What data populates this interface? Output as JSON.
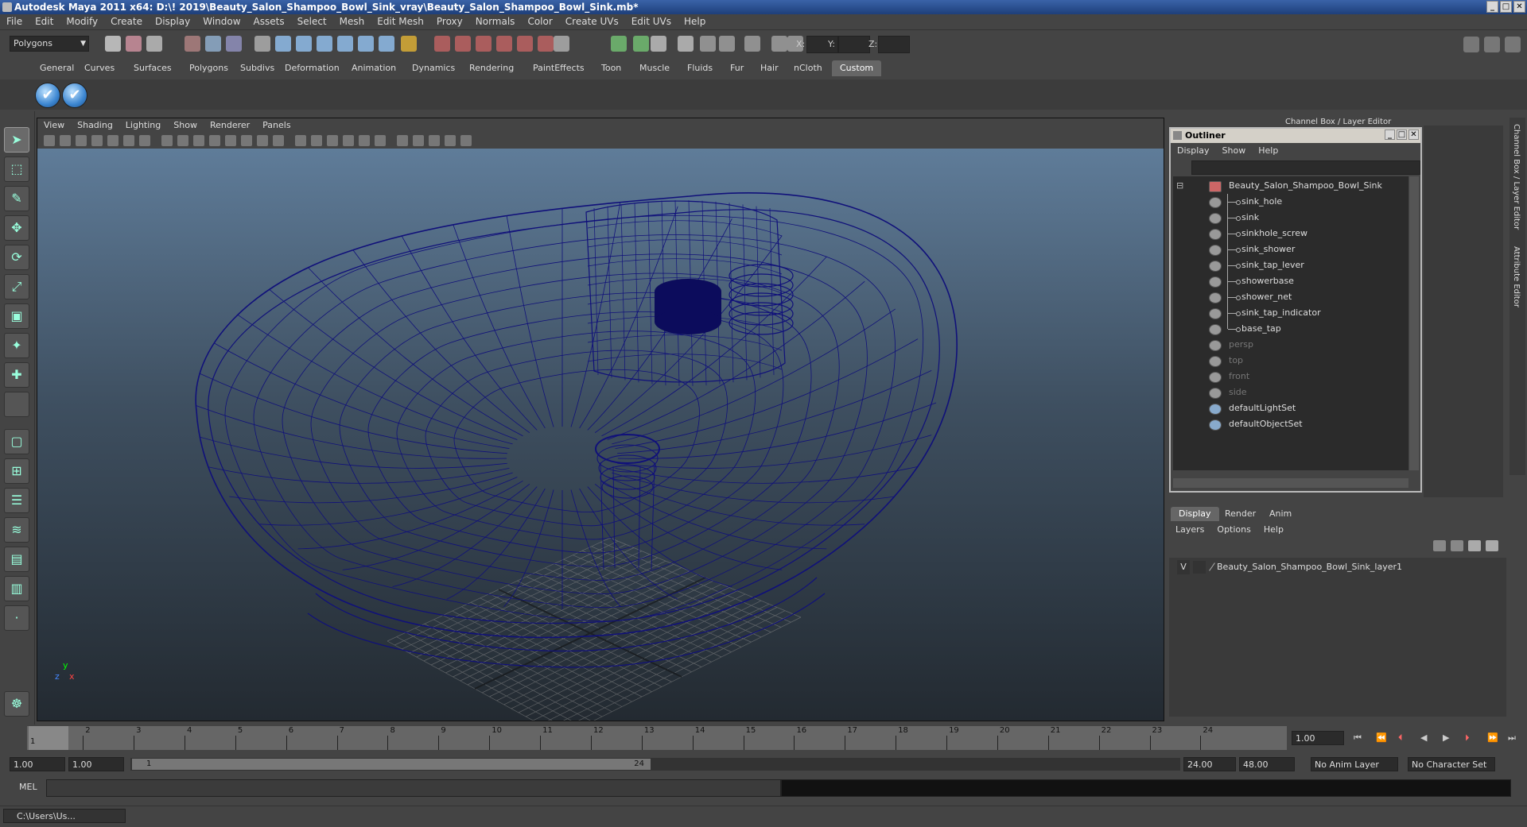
{
  "window": {
    "title": "Autodesk Maya 2011 x64: D:\\! 2019\\Beauty_Salon_Shampoo_Bowl_Sink_vray\\Beauty_Salon_Shampoo_Bowl_Sink.mb*"
  },
  "menubar": [
    "File",
    "Edit",
    "Modify",
    "Create",
    "Display",
    "Window",
    "Assets",
    "Select",
    "Mesh",
    "Edit Mesh",
    "Proxy",
    "Normals",
    "Color",
    "Create UVs",
    "Edit UVs",
    "Help"
  ],
  "statusline": {
    "mode_dropdown": "Polygons",
    "x_label": "X:",
    "y_label": "Y:",
    "z_label": "Z:"
  },
  "shelf": {
    "tabs": [
      "General",
      "Curves",
      "Surfaces",
      "Polygons",
      "Subdivs",
      "Deformation",
      "Animation",
      "Dynamics",
      "Rendering",
      "PaintEffects",
      "Toon",
      "Muscle",
      "Fluids",
      "Fur",
      "Hair",
      "nCloth",
      "Custom"
    ],
    "active_tab": "Custom"
  },
  "viewport": {
    "menus": [
      "View",
      "Shading",
      "Lighting",
      "Show",
      "Renderer",
      "Panels"
    ],
    "axis_y": "y",
    "axis_x": "x",
    "axis_z": "z",
    "wire_color": "#10107a"
  },
  "channel_box_label": "Channel Box / Layer Editor",
  "outliner": {
    "title": "Outliner",
    "menus": [
      "Display",
      "Show",
      "Help"
    ],
    "root": "Beauty_Salon_Shampoo_Bowl_Sink",
    "children": [
      "sink_hole",
      "sink",
      "sinkhole_screw",
      "sink_shower",
      "sink_tap_lever",
      "showerbase",
      "shower_net",
      "sink_tap_indicator",
      "base_tap"
    ],
    "cameras": [
      "persp",
      "top",
      "front",
      "side"
    ],
    "sets": [
      "defaultLightSet",
      "defaultObjectSet"
    ]
  },
  "layer_editor": {
    "tabs": [
      "Display",
      "Render",
      "Anim"
    ],
    "active_tab": "Display",
    "menus": [
      "Layers",
      "Options",
      "Help"
    ],
    "layer_visibility": "V",
    "layer_name": "Beauty_Salon_Shampoo_Bowl_Sink_layer1"
  },
  "side_tabs": [
    "Channel Box / Layer Editor",
    "Attribute Editor"
  ],
  "timeslider": {
    "ticks": [
      "1",
      "2",
      "3",
      "4",
      "5",
      "6",
      "7",
      "8",
      "9",
      "10",
      "11",
      "12",
      "13",
      "14",
      "15",
      "16",
      "17",
      "18",
      "19",
      "20",
      "21",
      "22",
      "23",
      "24"
    ],
    "current_frame_marker": "1",
    "current_frame": "1.00"
  },
  "range": {
    "start": "1.00",
    "playback_start": "1.00",
    "knob_start": "1",
    "knob_end": "24",
    "playback_end": "24.00",
    "end": "48.00",
    "anim_layer": "No Anim Layer",
    "character_set": "No Character Set"
  },
  "command_line": {
    "label": "MEL"
  },
  "taskbar": {
    "item": "C:\\Users\\Us..."
  }
}
